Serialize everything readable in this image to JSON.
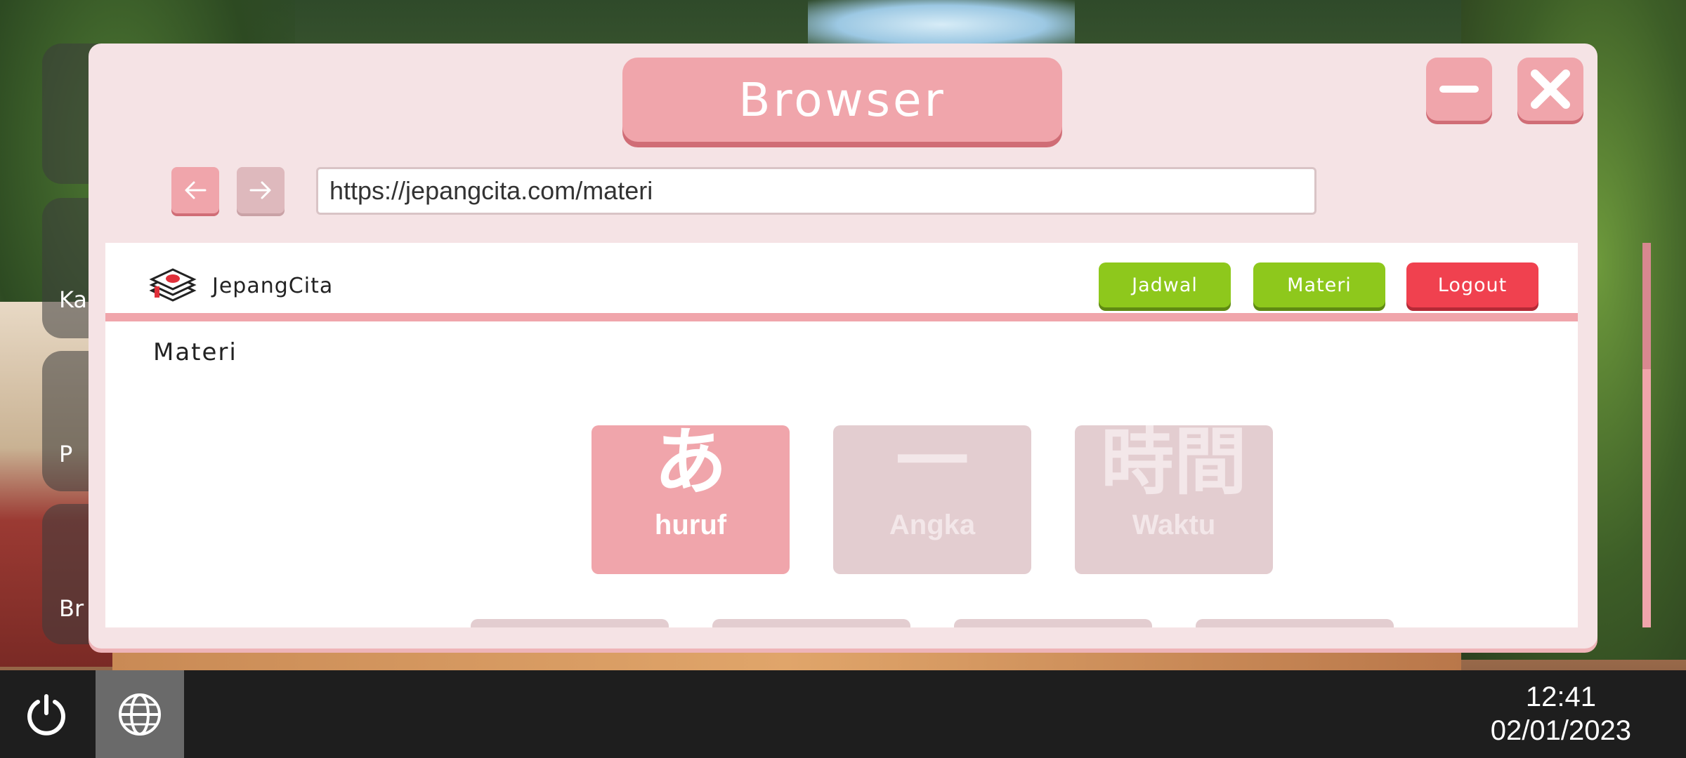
{
  "window": {
    "title": "Browser",
    "url": "https://jepangcita.com/materi"
  },
  "site": {
    "name": "JepangCita",
    "nav": {
      "jadwal": "Jadwal",
      "materi": "Materi",
      "logout": "Logout"
    },
    "heading": "Materi",
    "cards": [
      {
        "glyph": "あ",
        "label": "huruf",
        "state": "active"
      },
      {
        "glyph": "一",
        "label": "Angka",
        "state": "inactive"
      },
      {
        "glyph": "時間",
        "label": "Waktu",
        "state": "inactive"
      }
    ]
  },
  "desktop": {
    "icon_labels": [
      "Ka",
      "P",
      "Br"
    ]
  },
  "taskbar": {
    "time": "12:41",
    "date": "02/01/2023"
  },
  "colors": {
    "accent_pink": "#f0a5ab",
    "green_button": "#8ec81c",
    "red_button": "#f0414f"
  }
}
